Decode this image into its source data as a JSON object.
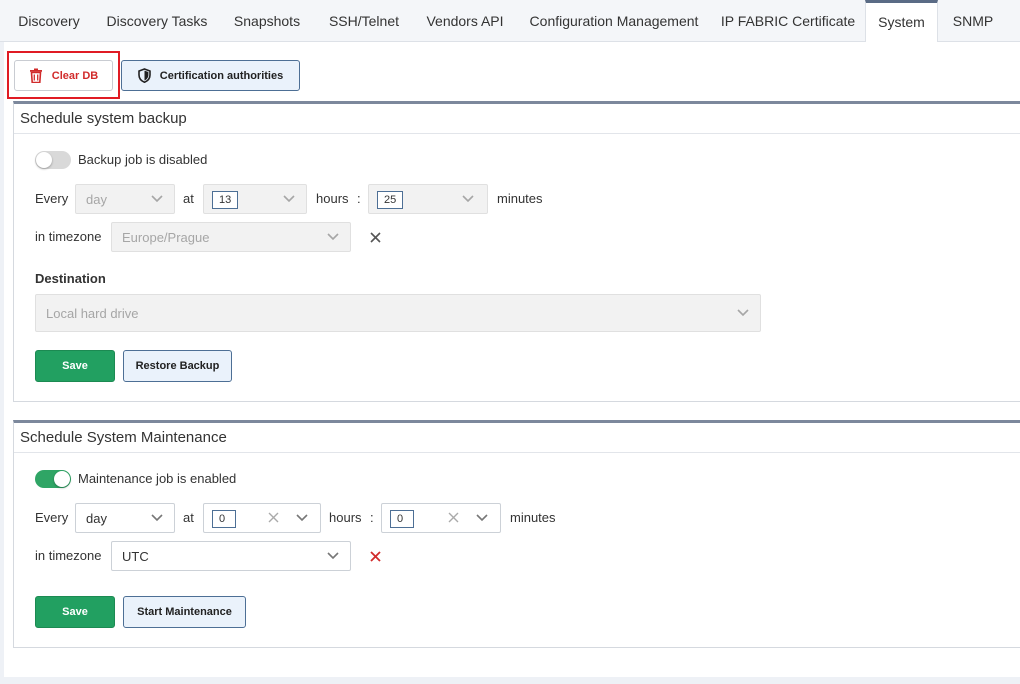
{
  "tabs": [
    {
      "label": "Discovery"
    },
    {
      "label": "Discovery Tasks"
    },
    {
      "label": "Snapshots"
    },
    {
      "label": "SSH/Telnet"
    },
    {
      "label": "Vendors API"
    },
    {
      "label": "Configuration Management"
    },
    {
      "label": "IP FABRIC Certificate"
    },
    {
      "label": "System",
      "active": true
    },
    {
      "label": "SNMP"
    }
  ],
  "toolbar": {
    "clear_db_label": "Clear DB",
    "clear_db_icon": "trash-icon",
    "cert_label": "Certification authorities",
    "cert_icon": "shield-icon"
  },
  "backup": {
    "title": "Schedule system backup",
    "toggle_label": "Backup job is disabled",
    "enabled": false,
    "every_label": "Every",
    "period_value": "day",
    "at_label": "at",
    "hours_value": "13",
    "hours_label": "hours",
    "colon": ":",
    "minutes_value": "25",
    "minutes_label": "minutes",
    "timezone_label": "in timezone",
    "timezone_value": "Europe/Prague",
    "destination_label": "Destination",
    "destination_value": "Local hard drive",
    "save_label": "Save",
    "restore_label": "Restore Backup"
  },
  "maintenance": {
    "title": "Schedule System Maintenance",
    "toggle_label": "Maintenance job is enabled",
    "enabled": true,
    "every_label": "Every",
    "period_value": "day",
    "at_label": "at",
    "hours_value": "0",
    "hours_label": "hours",
    "colon": ":",
    "minutes_value": "0",
    "minutes_label": "minutes",
    "timezone_label": "in timezone",
    "timezone_value": "UTC",
    "save_label": "Save",
    "start_label": "Start Maintenance"
  },
  "colors": {
    "accent_green": "#22a061",
    "danger_red": "#d12b2b",
    "highlight_red": "#e01b24",
    "tab_active_border": "#5a6b85"
  }
}
